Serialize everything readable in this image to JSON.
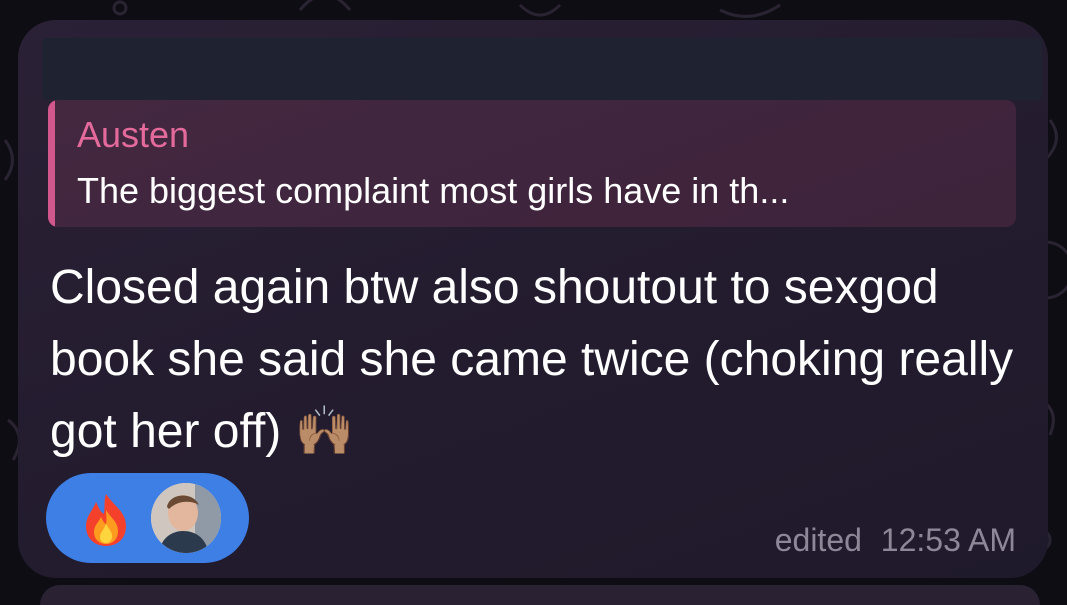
{
  "reply": {
    "author": "Austen",
    "preview": "The biggest complaint most girls have in th..."
  },
  "message": {
    "text": "Closed again btw also shoutout to sexgod book she said she came twice (choking really got her off) 🙌🏽"
  },
  "reactions": [
    {
      "emoji": "fire",
      "reactor": "avatar"
    }
  ],
  "meta": {
    "edited_label": "edited",
    "time": "12:53 AM"
  },
  "colors": {
    "reply_accent": "#d1578d",
    "reaction_pill": "#3e7fe6",
    "timestamp": "#8e8797"
  }
}
